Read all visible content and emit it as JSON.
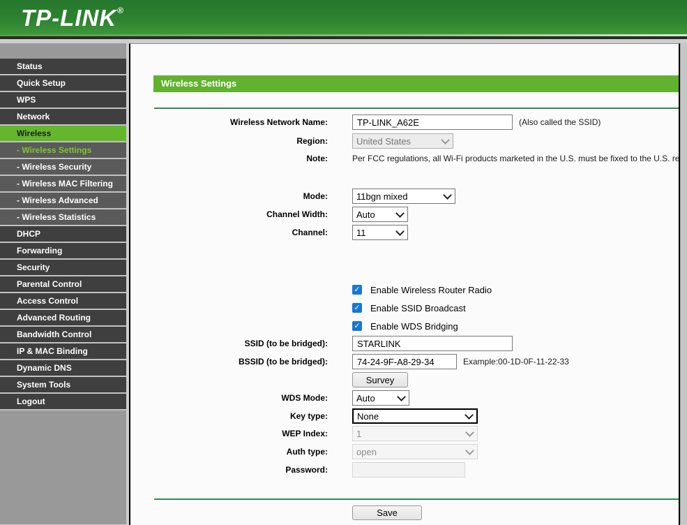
{
  "header": {
    "logo": "TP-LINK",
    "registered_mark": "®"
  },
  "sidebar": {
    "items": [
      {
        "label": "Status"
      },
      {
        "label": "Quick Setup"
      },
      {
        "label": "WPS"
      },
      {
        "label": "Network"
      },
      {
        "label": "Wireless",
        "active": true
      },
      {
        "label": "- Wireless Settings",
        "sub": true,
        "active_sub": true
      },
      {
        "label": "- Wireless Security",
        "sub": true
      },
      {
        "label": "- Wireless MAC Filtering",
        "sub": true
      },
      {
        "label": "- Wireless Advanced",
        "sub": true
      },
      {
        "label": "- Wireless Statistics",
        "sub": true
      },
      {
        "label": "DHCP"
      },
      {
        "label": "Forwarding"
      },
      {
        "label": "Security"
      },
      {
        "label": "Parental Control"
      },
      {
        "label": "Access Control"
      },
      {
        "label": "Advanced Routing"
      },
      {
        "label": "Bandwidth Control"
      },
      {
        "label": "IP & MAC Binding"
      },
      {
        "label": "Dynamic DNS"
      },
      {
        "label": "System Tools"
      },
      {
        "label": "Logout"
      }
    ]
  },
  "main": {
    "title": "Wireless Settings",
    "fields": {
      "network_name_label": "Wireless Network Name:",
      "network_name_value": "TP-LINK_A62E",
      "network_name_hint": "(Also called the SSID)",
      "region_label": "Region:",
      "region_value": "United States",
      "note_label": "Note:",
      "note_text": "Per FCC regulations, all Wi-Fi products marketed in the U.S. must be fixed to the U.S. reg",
      "mode_label": "Mode:",
      "mode_value": "11bgn mixed",
      "channel_width_label": "Channel Width:",
      "channel_width_value": "Auto",
      "channel_label": "Channel:",
      "channel_value": "11",
      "checkbox_radio_label": "Enable Wireless Router Radio",
      "checkbox_ssid_label": "Enable SSID Broadcast",
      "checkbox_wds_label": "Enable WDS Bridging",
      "checkbox_check": "✓",
      "ssid_bridged_label": "SSID (to be bridged):",
      "ssid_bridged_value": "STARLINK",
      "bssid_bridged_label": "BSSID (to be bridged):",
      "bssid_bridged_value": "74-24-9F-A8-29-34",
      "bssid_example": "Example:00-1D-0F-11-22-33",
      "survey_button": "Survey",
      "wds_mode_label": "WDS Mode:",
      "wds_mode_value": "Auto",
      "key_type_label": "Key type:",
      "key_type_value": "None",
      "wep_index_label": "WEP Index:",
      "wep_index_value": "1",
      "auth_type_label": "Auth type:",
      "auth_type_value": "open",
      "password_label": "Password:",
      "password_value": ""
    },
    "save_button": "Save"
  },
  "colors": {
    "header_green_top": "#26772c",
    "header_green_bottom": "#42993a",
    "title_bar_green": "#61b22e",
    "divider_green": "#2e8b56",
    "sidebar_bg": "#999999",
    "menu_item_bg": "#3f3f3f",
    "menu_sub_bg": "#5a5a5a",
    "active_item_green": "#64b72c",
    "active_sub_text_green": "#7ec82b",
    "checkbox_blue": "#1977d4"
  }
}
